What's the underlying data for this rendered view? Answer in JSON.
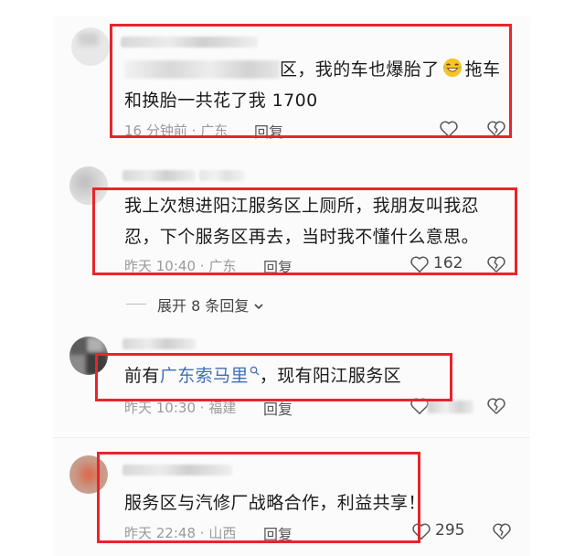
{
  "comments": [
    {
      "text_line1_suffix": "区，我的车也爆胎了",
      "text_line1_tail": "拖车",
      "text_line2": "和换胎一共花了我 1700",
      "time": "16 分钟前",
      "region": "广东",
      "reply_label": "回复",
      "like_count": "",
      "emoji": "rofl-emoji"
    },
    {
      "text_line1": "我上次想进阳江服务区上厕所，我朋友叫我忍",
      "text_line2": "忍，下个服务区再去，当时我不懂什么意思。",
      "time": "昨天 10:40",
      "region": "广东",
      "reply_label": "回复",
      "like_count": "162"
    },
    {
      "text_prefix": "前有",
      "text_link": "广东索马里",
      "text_suffix": "，现有阳江服务区",
      "time": "昨天 10:30",
      "region": "福建",
      "reply_label": "回复",
      "like_count": ""
    },
    {
      "text_line1": "服务区与汽修厂战略合作，利益共享！",
      "time": "昨天 22:48",
      "region": "山西",
      "reply_label": "回复",
      "like_count": "295"
    }
  ],
  "expand_replies_label": "展开 8 条回复",
  "separator": "·",
  "colors": {
    "highlight_border": "#e8252b",
    "link": "#3f6fb8",
    "meta": "#9a9a9a"
  }
}
